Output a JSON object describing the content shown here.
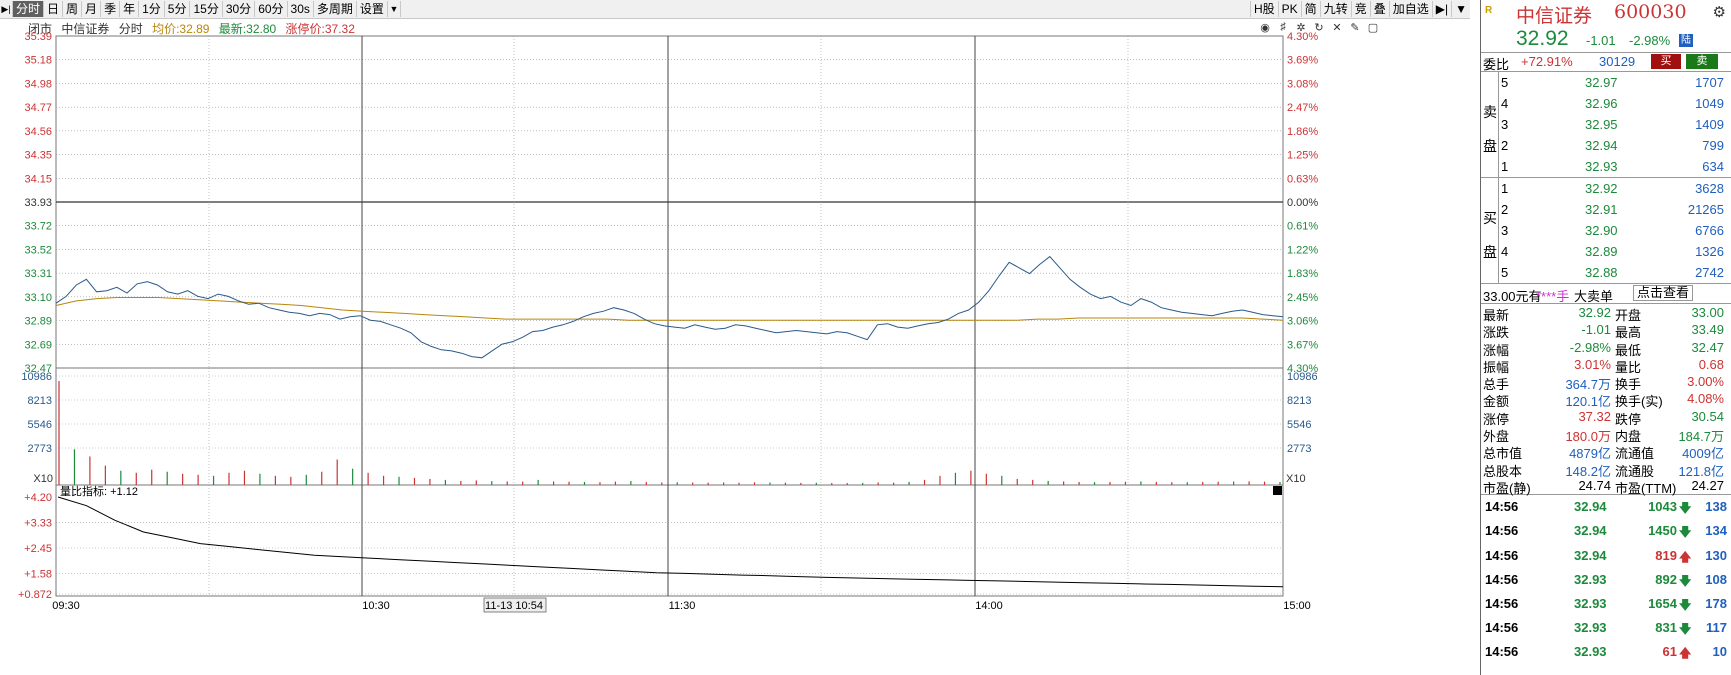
{
  "toolbar": {
    "left": [
      "分时",
      "日",
      "周",
      "月",
      "季",
      "年",
      "1分",
      "5分",
      "15分",
      "30分",
      "60分",
      "30s",
      "多周期",
      "设置"
    ],
    "active_index": 0,
    "right": [
      "H股",
      "PK",
      "简",
      "九转",
      "竞",
      "叠",
      "加自选"
    ]
  },
  "info": {
    "status": "闭市",
    "name": "中信证券",
    "mode": "分时",
    "avg_label": "均价:",
    "avg": "32.89",
    "last_label": "最新:",
    "last": "32.80",
    "limit_label": "涨停价:",
    "limit": "37.32"
  },
  "chart_data": {
    "type": "line",
    "price_axis_left": [
      "35.39",
      "35.18",
      "34.98",
      "34.77",
      "34.56",
      "34.35",
      "34.15",
      "33.93",
      "33.72",
      "33.52",
      "33.31",
      "33.10",
      "32.89",
      "32.69",
      "32.47"
    ],
    "price_axis_right": [
      "4.30%",
      "3.69%",
      "3.08%",
      "2.47%",
      "1.86%",
      "1.25%",
      "0.63%",
      "0.00%",
      "0.61%",
      "1.22%",
      "1.83%",
      "2.45%",
      "3.06%",
      "3.67%",
      "4.30%"
    ],
    "prev_close": 33.93,
    "ylim": [
      32.47,
      35.39
    ],
    "volume_axis": [
      "10986",
      "8213",
      "5546",
      "2773"
    ],
    "volume_unit": "X10",
    "vr_label": "量比指标: +1.12",
    "vr_axis": [
      "+4.20",
      "+3.33",
      "+2.45",
      "+1.58",
      "+0.872"
    ],
    "time_labels": [
      "09:30",
      "10:30",
      "11-13 10:54",
      "11:30",
      "14:00",
      "15:00"
    ],
    "price": [
      33.04,
      33.1,
      33.2,
      33.25,
      33.14,
      33.15,
      33.18,
      33.13,
      33.21,
      33.23,
      33.2,
      33.14,
      33.12,
      33.15,
      33.1,
      33.08,
      33.12,
      33.1,
      33.06,
      33.03,
      33.04,
      33.0,
      32.98,
      32.96,
      32.95,
      32.93,
      32.95,
      32.94,
      32.9,
      32.92,
      32.93,
      32.89,
      32.88,
      32.85,
      32.82,
      32.78,
      32.7,
      32.66,
      32.63,
      32.62,
      32.6,
      32.57,
      32.56,
      32.62,
      32.68,
      32.7,
      32.74,
      32.79,
      32.8,
      32.83,
      32.85,
      32.88,
      32.92,
      32.95,
      32.97,
      33.0,
      32.98,
      32.95,
      32.9,
      32.86,
      32.84,
      32.83,
      32.82,
      32.85,
      32.83,
      32.81,
      32.82,
      32.85,
      32.84,
      32.82,
      32.8,
      32.78,
      32.79,
      32.8,
      32.79,
      32.78,
      32.77,
      32.79,
      32.78,
      32.75,
      32.72,
      32.85,
      32.86,
      32.83,
      32.82,
      32.84,
      32.86,
      32.87,
      32.9,
      32.95,
      32.98,
      33.05,
      33.15,
      33.28,
      33.4,
      33.35,
      33.3,
      33.38,
      33.45,
      33.35,
      33.25,
      33.18,
      33.12,
      33.08,
      33.1,
      33.05,
      33.02,
      33.08,
      33.05,
      33.0,
      32.98,
      32.96,
      32.95,
      32.94,
      32.93,
      32.95,
      32.97,
      32.98,
      32.96,
      32.94,
      32.93,
      32.92
    ],
    "avg": [
      33.02,
      33.06,
      33.08,
      33.09,
      33.09,
      33.09,
      33.08,
      33.07,
      33.06,
      33.05,
      33.04,
      33.03,
      33.02,
      33.0,
      32.98,
      32.97,
      32.96,
      32.95,
      32.94,
      32.93,
      32.92,
      32.91,
      32.9,
      32.9,
      32.9,
      32.9,
      32.9,
      32.9,
      32.89,
      32.89,
      32.89,
      32.89,
      32.89,
      32.89,
      32.89,
      32.89,
      32.89,
      32.89,
      32.89,
      32.89,
      32.89,
      32.89,
      32.89,
      32.89,
      32.89,
      32.89,
      32.89,
      32.89,
      32.9,
      32.9,
      32.91,
      32.91,
      32.91,
      32.91,
      32.91,
      32.91,
      32.91,
      32.91,
      32.91,
      32.9,
      32.89
    ],
    "volume": [
      10200,
      3500,
      2800,
      1900,
      1400,
      1200,
      1500,
      1300,
      1100,
      1000,
      900,
      1200,
      1400,
      1100,
      900,
      800,
      1000,
      1300,
      2500,
      1600,
      1200,
      900,
      800,
      700,
      600,
      500,
      400,
      450,
      380,
      350,
      330,
      500,
      350,
      320,
      300,
      280,
      330,
      400,
      300,
      250,
      260,
      240,
      230,
      250,
      220,
      260,
      240,
      230,
      210,
      220,
      200,
      190,
      210,
      250,
      230,
      300,
      500,
      900,
      1200,
      1400,
      1100,
      900,
      600,
      500,
      400,
      350,
      300,
      280,
      300,
      320,
      350,
      300,
      280,
      270,
      300,
      320,
      340,
      360,
      330,
      300
    ],
    "vr": [
      4.2,
      3.9,
      3.4,
      3.0,
      2.8,
      2.6,
      2.5,
      2.4,
      2.3,
      2.2,
      2.15,
      2.1,
      2.05,
      2.0,
      1.95,
      1.9,
      1.85,
      1.8,
      1.75,
      1.7,
      1.65,
      1.6,
      1.58,
      1.55,
      1.52,
      1.5,
      1.47,
      1.44,
      1.42,
      1.4,
      1.38,
      1.36,
      1.34,
      1.32,
      1.3,
      1.28,
      1.26,
      1.24,
      1.22,
      1.2,
      1.18,
      1.16,
      1.14,
      1.12
    ]
  },
  "quote": {
    "code_tag": "R",
    "name": "中信证券",
    "code": "600030",
    "price": "32.92",
    "change": "-1.01",
    "change_pct": "-2.98%",
    "exchange_tag": "陆",
    "wb_label": "委比",
    "wb_pct": "+72.91%",
    "wb_num": "30129",
    "buy_btn": "买",
    "sell_btn": "卖"
  },
  "asks": [
    {
      "lv": "5",
      "p": "32.97",
      "v": "1707"
    },
    {
      "lv": "4",
      "p": "32.96",
      "v": "1049"
    },
    {
      "lv": "3",
      "p": "32.95",
      "v": "1409"
    },
    {
      "lv": "2",
      "p": "32.94",
      "v": "799"
    },
    {
      "lv": "1",
      "p": "32.93",
      "v": "634"
    }
  ],
  "bids": [
    {
      "lv": "1",
      "p": "32.92",
      "v": "3628"
    },
    {
      "lv": "2",
      "p": "32.91",
      "v": "21265"
    },
    {
      "lv": "3",
      "p": "32.90",
      "v": "6766"
    },
    {
      "lv": "4",
      "p": "32.89",
      "v": "1326"
    },
    {
      "lv": "5",
      "p": "32.88",
      "v": "2742"
    }
  ],
  "ask_side": [
    "卖",
    "盘"
  ],
  "bid_side": [
    "买",
    "盘"
  ],
  "bigorder": {
    "a": "33.00元有",
    "b": "****手",
    "c": "大卖单",
    "d": "点击查看"
  },
  "stats": [
    {
      "k1": "最新",
      "v1": "32.92",
      "c1": "g",
      "k2": "开盘",
      "v2": "33.00",
      "c2": "g"
    },
    {
      "k1": "涨跌",
      "v1": "-1.01",
      "c1": "g",
      "k2": "最高",
      "v2": "33.49",
      "c2": "g"
    },
    {
      "k1": "涨幅",
      "v1": "-2.98%",
      "c1": "g",
      "k2": "最低",
      "v2": "32.47",
      "c2": "g"
    },
    {
      "k1": "振幅",
      "v1": "3.01%",
      "c1": "rd",
      "k2": "量比",
      "v2": "0.68",
      "c2": "rd"
    },
    {
      "k1": "总手",
      "v1": "364.7万",
      "c1": "bl",
      "k2": "换手",
      "v2": "3.00%",
      "c2": "rd"
    },
    {
      "k1": "金额",
      "v1": "120.1亿",
      "c1": "bl",
      "k2": "换手(实)",
      "v2": "4.08%",
      "c2": "rd"
    },
    {
      "k1": "涨停",
      "v1": "37.32",
      "c1": "rd",
      "k2": "跌停",
      "v2": "30.54",
      "c2": "g"
    },
    {
      "k1": "外盘",
      "v1": "180.0万",
      "c1": "rd",
      "k2": "内盘",
      "v2": "184.7万",
      "c2": "g"
    },
    {
      "k1": "总市值",
      "v1": "4879亿",
      "c1": "bl",
      "k2": "流通值",
      "v2": "4009亿",
      "c2": "bl"
    },
    {
      "k1": "总股本",
      "v1": "148.2亿",
      "c1": "bl",
      "k2": "流通股",
      "v2": "121.8亿",
      "c2": "bl"
    },
    {
      "k1": "市盈(静)",
      "v1": "24.74",
      "c1": "",
      "k2": "市盈(TTM)",
      "v2": "24.27",
      "c2": ""
    }
  ],
  "trades": [
    {
      "t": "14:56",
      "p": "32.94",
      "v": "1043",
      "dir": "down",
      "n": "138"
    },
    {
      "t": "14:56",
      "p": "32.94",
      "v": "1450",
      "dir": "down",
      "n": "134"
    },
    {
      "t": "14:56",
      "p": "32.94",
      "v": "819",
      "dir": "up",
      "n": "130"
    },
    {
      "t": "14:56",
      "p": "32.93",
      "v": "892",
      "dir": "down",
      "n": "108"
    },
    {
      "t": "14:56",
      "p": "32.93",
      "v": "1654",
      "dir": "down",
      "n": "178"
    },
    {
      "t": "14:56",
      "p": "32.93",
      "v": "831",
      "dir": "down",
      "n": "117"
    },
    {
      "t": "14:56",
      "p": "32.93",
      "v": "61",
      "dir": "up",
      "n": "10"
    }
  ],
  "colors": {
    "up": "#cc3333",
    "down": "#1c8a3b",
    "price_line": "#2a5a8a",
    "avg_line": "#b8860b",
    "grid": "#999999"
  }
}
